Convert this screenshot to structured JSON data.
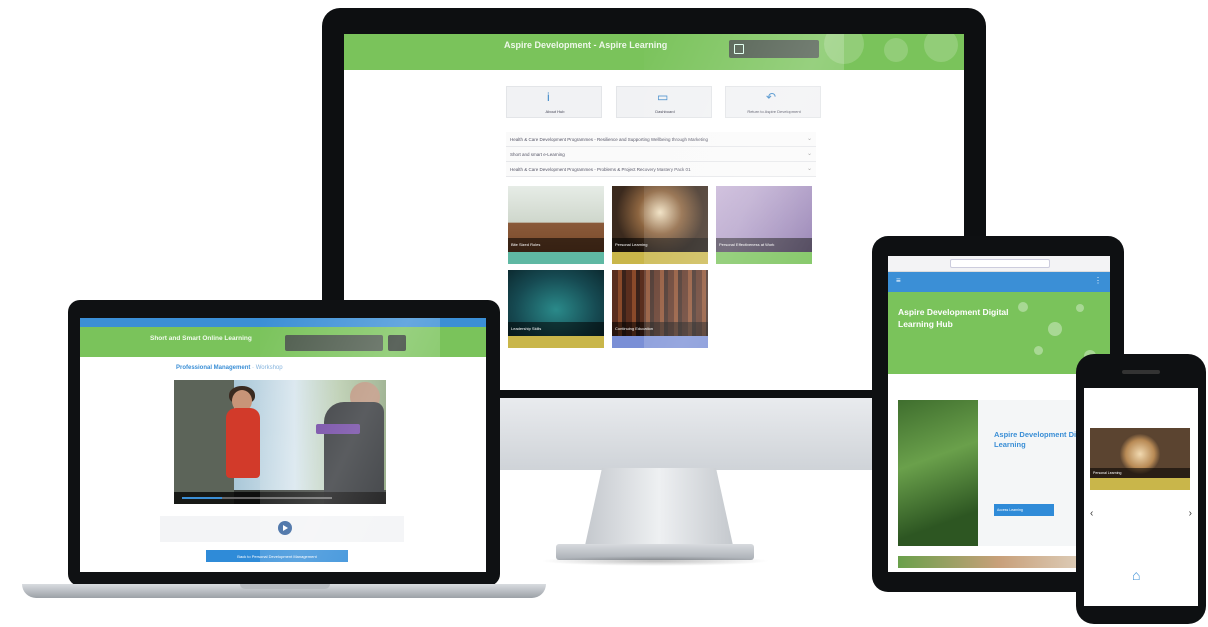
{
  "desktop": {
    "site_title": "Aspire Development - Aspire Learning",
    "tiles": [
      {
        "icon": "i",
        "label": "About Hub"
      },
      {
        "icon": "▭",
        "label": "Dashboard"
      },
      {
        "icon": "↶",
        "label": "Return to Aspire Development"
      }
    ],
    "list_rows": [
      "Health & Care Development Programmes - Resilience and Supporting Wellbeing through Marketing",
      "Short and smart e-Learning",
      "Health & Care Development Programmes - Problems & Project Recovery Mastery Pack 01"
    ],
    "cards": [
      {
        "caption": "Bite Sized Roles",
        "bar_color": "#5fb8a3"
      },
      {
        "caption": "Personal Learning",
        "bar_color": "#c9b64a"
      },
      {
        "caption": "Personal Effectiveness at Work",
        "bar_color": "#7ac35b"
      },
      {
        "caption": "Leadership Skills",
        "bar_color": "#c9b64a"
      },
      {
        "caption": "Continuing Education",
        "bar_color": "#7a8fd6"
      }
    ]
  },
  "laptop": {
    "header_title": "Short and Smart Online Learning",
    "breadcrumb_main": "Professional Management",
    "breadcrumb_sub": "· Workshop",
    "cta_label": "Back to Personal Development Management"
  },
  "tablet": {
    "hero_title": "Aspire Development Digital Learning Hub",
    "banner_title": "Aspire Development Digital Learning",
    "banner_button": "Access Learning"
  },
  "phone": {
    "card_caption": "Personal Learning"
  },
  "colors": {
    "brand_green": "#7ac35b",
    "brand_blue": "#3b8fd6",
    "bezel": "#0e1012"
  }
}
